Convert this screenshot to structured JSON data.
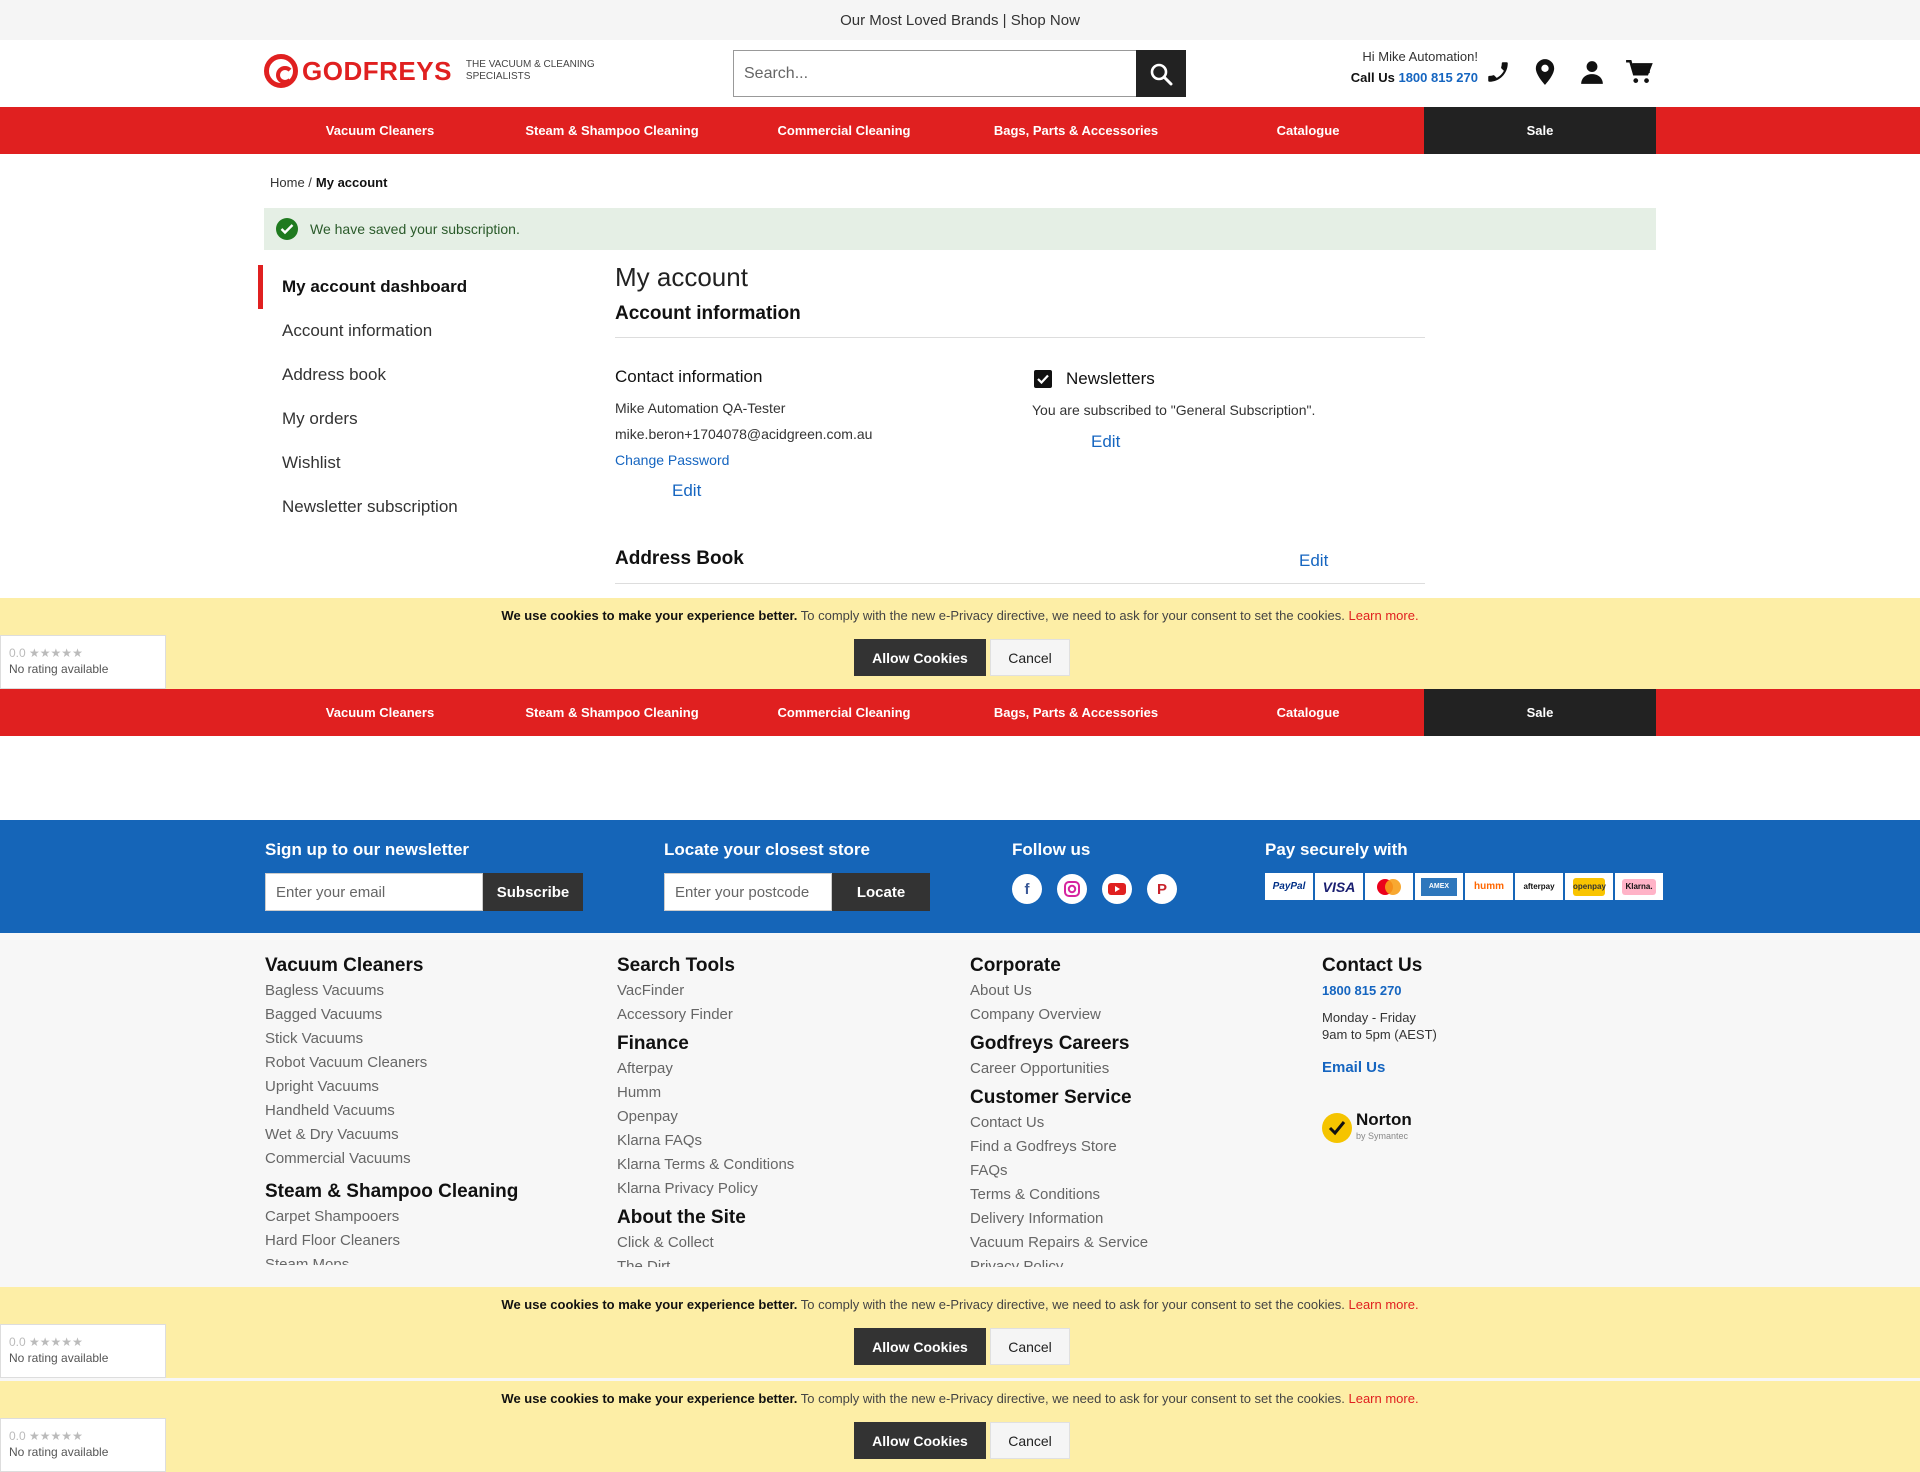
{
  "topbar": {
    "text": "Our Most Loved Brands | Shop Now"
  },
  "header": {
    "brand": "GODFREYS",
    "tagline": "THE VACUUM & CLEANING SPECIALISTS",
    "search_placeholder": "Search...",
    "greeting": "Hi Mike Automation!",
    "call_label": "Call Us",
    "phone": "1800 815 270",
    "icons": [
      "phone-icon",
      "location-pin-icon",
      "user-icon",
      "cart-icon"
    ]
  },
  "nav": {
    "items": [
      "Vacuum Cleaners",
      "Steam & Shampoo Cleaning",
      "Commercial Cleaning",
      "Bags, Parts & Accessories",
      "Catalogue",
      "Sale"
    ]
  },
  "breadcrumb": {
    "home": "Home /",
    "current": "My account"
  },
  "notice": {
    "message": "We have saved your subscription."
  },
  "sidebar": {
    "items": [
      "My account dashboard",
      "Account information",
      "Address book",
      "My orders",
      "Wishlist",
      "Newsletter subscription"
    ]
  },
  "account": {
    "title": "My account",
    "section": "Account information",
    "contact": {
      "heading": "Contact information",
      "name": "Mike Automation QA-Tester",
      "email": "mike.beron+1704078@acidgreen.com.au",
      "change_password": "Change Password",
      "edit": "Edit"
    },
    "newsletters": {
      "heading": "Newsletters",
      "status": "You are subscribed to \"General Subscription\".",
      "edit": "Edit"
    },
    "address_book": {
      "heading": "Address Book",
      "edit": "Edit"
    }
  },
  "cookie": {
    "bold": "We use cookies to make your experience better.",
    "text": " To comply with the new e-Privacy directive, we need to ask for your consent to set the cookies. ",
    "learn": "Learn more.",
    "allow": "Allow Cookies",
    "cancel": "Cancel"
  },
  "rating": {
    "score": "0.0",
    "stars": "★★★★★",
    "label": "No rating available"
  },
  "newsletter_band": {
    "heading": "Sign up to our newsletter",
    "placeholder": "Enter your email",
    "button": "Subscribe"
  },
  "store_band": {
    "heading": "Locate your closest store",
    "placeholder": "Enter your postcode",
    "button": "Locate"
  },
  "follow": {
    "heading": "Follow us",
    "icons": [
      "facebook-icon",
      "instagram-icon",
      "youtube-icon",
      "pinterest-icon"
    ]
  },
  "pay": {
    "heading": "Pay securely with",
    "methods": [
      "PayPal",
      "VISA",
      "mastercard",
      "AMEX",
      "humm",
      "afterpay",
      "openpay",
      "Klarna."
    ]
  },
  "footer": {
    "vacuum": {
      "heading": "Vacuum Cleaners",
      "links": [
        "Bagless Vacuums",
        "Bagged Vacuums",
        "Stick Vacuums",
        "Robot Vacuum Cleaners",
        "Upright Vacuums",
        "Handheld Vacuums",
        "Wet & Dry Vacuums",
        "Commercial Vacuums"
      ]
    },
    "steam": {
      "heading": "Steam & Shampoo Cleaning",
      "links": [
        "Carpet Shampooers",
        "Hard Floor Cleaners",
        "Steam Mops"
      ]
    },
    "search": {
      "heading": "Search Tools",
      "links": [
        "VacFinder",
        "Accessory Finder"
      ]
    },
    "finance": {
      "heading": "Finance",
      "links": [
        "Afterpay",
        "Humm",
        "Openpay",
        "Klarna FAQs",
        "Klarna Terms & Conditions",
        "Klarna Privacy Policy"
      ]
    },
    "about": {
      "heading": "About the Site",
      "links": [
        "Click & Collect",
        "The Dirt"
      ]
    },
    "corporate": {
      "heading": "Corporate",
      "links": [
        "About Us",
        "Company Overview"
      ]
    },
    "careers": {
      "heading": "Godfreys Careers",
      "links": [
        "Career Opportunities"
      ]
    },
    "service": {
      "heading": "Customer Service",
      "links": [
        "Contact Us",
        "Find a Godfreys Store",
        "FAQs",
        "Terms & Conditions",
        "Delivery Information",
        "Vacuum Repairs & Service",
        "Privacy Policy"
      ]
    },
    "contact": {
      "heading": "Contact Us",
      "phone": "1800 815 270",
      "days": "Monday - Friday",
      "hours": "9am to 5pm (AEST)",
      "email": "Email Us"
    },
    "norton": {
      "name": "Norton",
      "by": "by Symantec"
    }
  }
}
